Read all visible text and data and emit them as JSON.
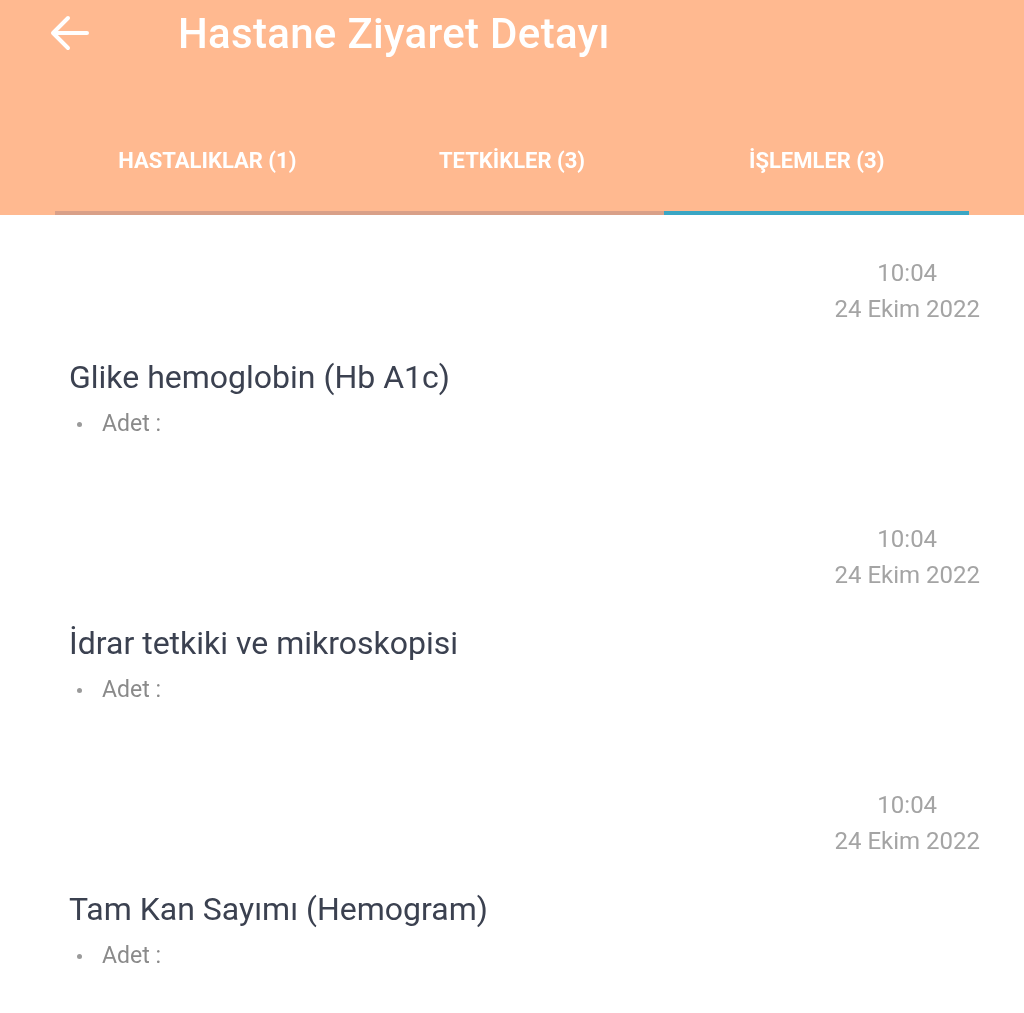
{
  "header": {
    "title": "Hastane Ziyaret Detayı"
  },
  "tabs": [
    {
      "label": "HASTALIKLAR (1)",
      "selected": false
    },
    {
      "label": "TETKİKLER (3)",
      "selected": false
    },
    {
      "label": "İŞLEMLER (3)",
      "selected": true
    }
  ],
  "procedures": [
    {
      "time": "10:04",
      "date": "24 Ekim 2022",
      "name": "Glike hemoglobin (Hb A1c)",
      "detail": "Adet :"
    },
    {
      "time": "10:04",
      "date": "24 Ekim 2022",
      "name": "İdrar tetkiki ve mikroskopisi",
      "detail": "Adet :"
    },
    {
      "time": "10:04",
      "date": "24 Ekim 2022",
      "name": "Tam Kan Sayımı (Hemogram)",
      "detail": "Adet :"
    }
  ]
}
